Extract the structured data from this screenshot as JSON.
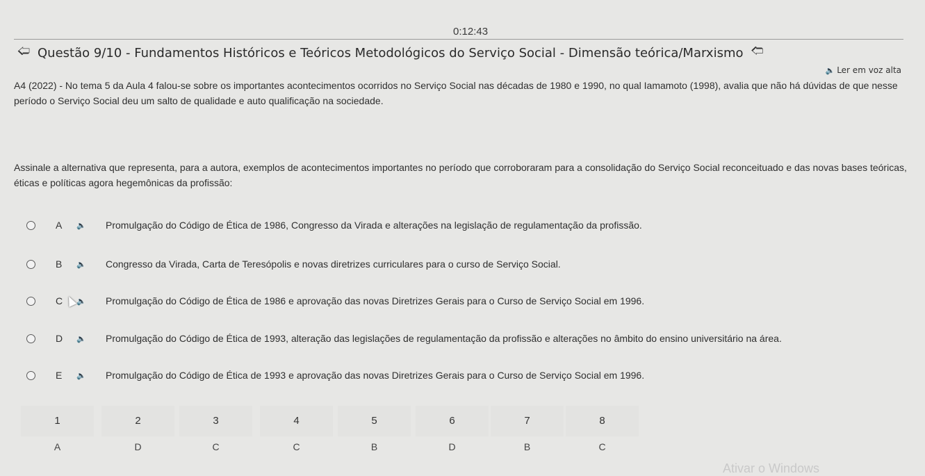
{
  "timer": "0:12:43",
  "header": {
    "prev_icon": "arrow-left-icon",
    "next_icon": "arrow-right-icon",
    "title": "Questão 9/10 - Fundamentos Históricos e Teóricos Metodológicos do Serviço Social - Dimensão teórica/Marxismo"
  },
  "read_aloud": {
    "icon": "speaker-icon",
    "label": "Ler em voz alta"
  },
  "question": {
    "statement": "A4 (2022) - No tema 5 da Aula 4 falou-se sobre os importantes acontecimentos ocorridos no Serviço Social nas décadas de 1980 e 1990, no qual Iamamoto (1998), avalia que não há dúvidas de que nesse período o Serviço Social deu um salto de qualidade e auto qualificação na sociedade.",
    "prompt": "Assinale a alternativa que representa, para a autora, exemplos de acontecimentos importantes no período que corroboraram para a consolidação do Serviço Social reconceituado e das novas bases teóricas, éticas e políticas agora hegemônicas da profissão:"
  },
  "options": [
    {
      "letter": "A",
      "text": "Promulgação do Código de Ética de 1986,  Congresso da Virada e alterações na legislação de regulamentação da profissão."
    },
    {
      "letter": "B",
      "text": "Congresso da Virada, Carta de Teresópolis e novas diretrizes curriculares para o curso de Serviço Social."
    },
    {
      "letter": "C",
      "text": "Promulgação do Código de Ética de 1986 e aprovação das novas Diretrizes Gerais para o Curso de Serviço Social em 1996."
    },
    {
      "letter": "D",
      "text": "Promulgação do Código de Ética de 1993, alteração das legislações de regulamentação da profissão e alterações no âmbito do ensino universitário na área."
    },
    {
      "letter": "E",
      "text": "Promulgação do Código de Ética de 1993 e aprovação das novas Diretrizes Gerais para o Curso de Serviço Social em 1996."
    }
  ],
  "option_speaker_icon": "speaker-icon",
  "question_nav": [
    {
      "number": "1",
      "answer": "A"
    },
    {
      "number": "2",
      "answer": "D"
    },
    {
      "number": "3",
      "answer": "C"
    },
    {
      "number": "4",
      "answer": "C"
    },
    {
      "number": "5",
      "answer": "B"
    },
    {
      "number": "6",
      "answer": "D"
    },
    {
      "number": "7",
      "answer": "B"
    },
    {
      "number": "8",
      "answer": "C"
    }
  ],
  "watermark": "Ativar o Windows"
}
